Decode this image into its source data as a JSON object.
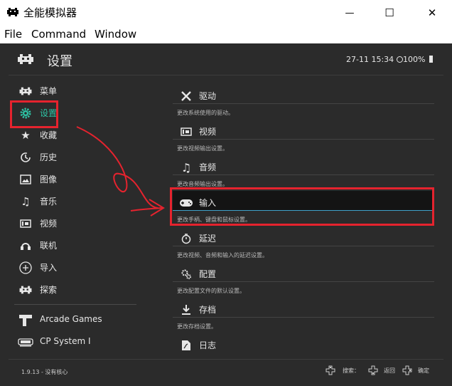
{
  "window": {
    "title": "全能模拟器",
    "minimize_glyph": "—",
    "maximize_glyph": "☐",
    "close_glyph": "✕"
  },
  "menubar": [
    "File",
    "Command",
    "Window"
  ],
  "header": {
    "title": "设置",
    "datetime": "27-11 15:34",
    "battery": "100%"
  },
  "sidebar": {
    "items": [
      {
        "label": "菜单",
        "icon": "invader-icon",
        "active": false
      },
      {
        "label": "设置",
        "icon": "gear-icon",
        "active": true
      },
      {
        "label": "收藏",
        "icon": "star-icon",
        "active": false
      },
      {
        "label": "历史",
        "icon": "history-icon",
        "active": false
      },
      {
        "label": "图像",
        "icon": "image-icon",
        "active": false
      },
      {
        "label": "音乐",
        "icon": "music-note-icon",
        "active": false
      },
      {
        "label": "视频",
        "icon": "film-icon",
        "active": false
      },
      {
        "label": "联机",
        "icon": "netplay-icon",
        "active": false
      },
      {
        "label": "导入",
        "icon": "plus-circle-icon",
        "active": false
      },
      {
        "label": "探索",
        "icon": "invader-icon",
        "active": false
      }
    ],
    "playlists": [
      {
        "label": "Arcade Games",
        "icon": "arcade-cabinet-icon"
      },
      {
        "label": "CP System I",
        "icon": "cps-icon"
      }
    ]
  },
  "settings_list": [
    {
      "label": "驱动",
      "sublabel": "更改系统使用的驱动。",
      "icon": "tools-icon",
      "selected": false
    },
    {
      "label": "视频",
      "sublabel": "更改视频输出设置。",
      "icon": "film-icon",
      "selected": false
    },
    {
      "label": "音频",
      "sublabel": "更改音频输出设置。",
      "icon": "music-note-icon",
      "selected": false
    },
    {
      "label": "输入",
      "sublabel": "更改手柄、键盘和鼠标设置。",
      "icon": "gamepad-icon",
      "selected": true
    },
    {
      "label": "延迟",
      "sublabel": "更改视频、音频和输入的延迟设置。",
      "icon": "timer-icon",
      "selected": false
    },
    {
      "label": "配置",
      "sublabel": "更改配置文件的默认设置。",
      "icon": "gears-icon",
      "selected": false
    },
    {
      "label": "存档",
      "sublabel": "更改存档设置。",
      "icon": "download-icon",
      "selected": false
    },
    {
      "label": "日志",
      "sublabel": "",
      "icon": "log-icon",
      "selected": false
    }
  ],
  "footer": {
    "version": "1.9.13 - 没有核心",
    "hints": [
      {
        "label": "搜索：",
        "icon": "dpad-icon"
      },
      {
        "label": "返回",
        "icon": "dpad-icon"
      },
      {
        "label": "确定",
        "icon": "dpad-icon"
      }
    ]
  },
  "colors": {
    "background": "#2b2b2b",
    "accent": "#2ec4a6",
    "selection_line": "#3fa1c9",
    "annotation": "#e5232e"
  }
}
